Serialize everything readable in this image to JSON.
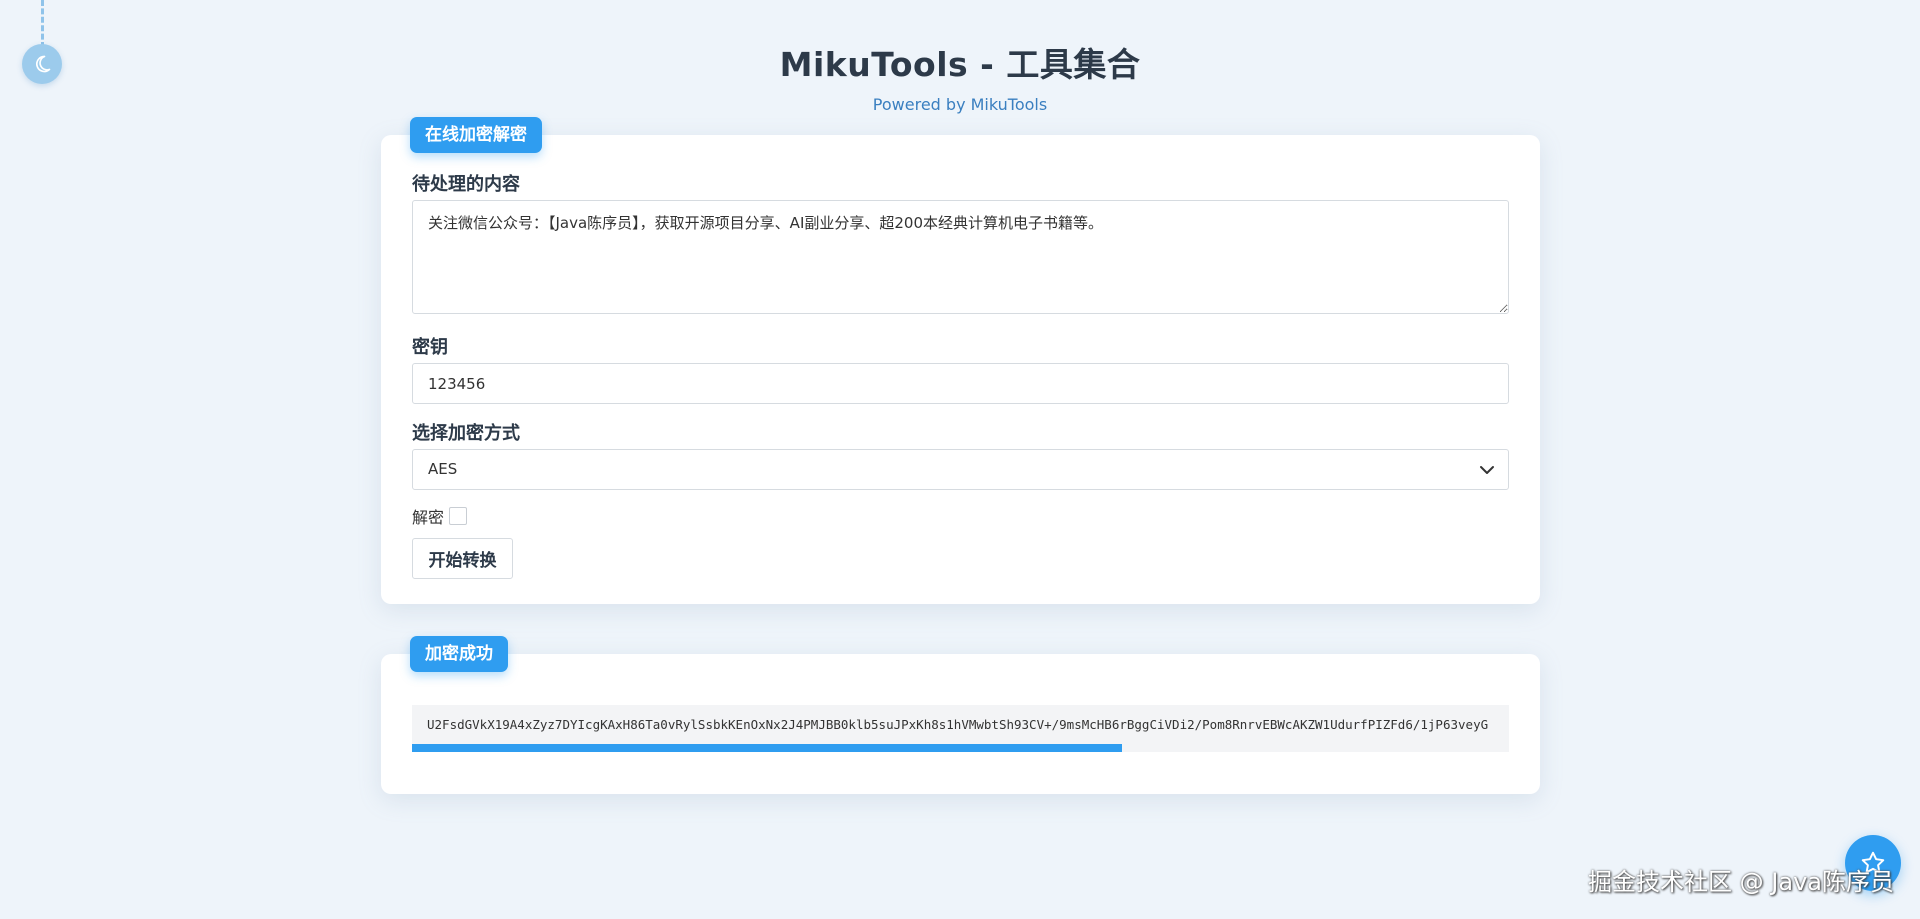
{
  "header": {
    "title": "MikuTools - 工具集合",
    "subtitle": "Powered by MikuTools"
  },
  "form_card": {
    "tag": "在线加密解密",
    "content_label": "待处理的内容",
    "content_value": "关注微信公众号：【Java陈序员】，获取开源项目分享、AI副业分享、超200本经典计算机电子书籍等。",
    "key_label": "密钥",
    "key_value": "123456",
    "method_label": "选择加密方式",
    "method_value": "AES",
    "decrypt_label": "解密",
    "decrypt_checked": false,
    "submit_label": "开始转换"
  },
  "result_card": {
    "tag": "加密成功",
    "output": "U2FsdGVkX19A4xZyz7DYIcgKAxH86Ta0vRylSsbkKEnOxNx2J4PMJBB0klb5suJPxKh8s1hVMwbtSh93CV+/9msMcHB6rBggCiVDi2/Pom8RnrvEBWcAKZW1UdurfPIZFd6/1jP63veyG",
    "progress_fraction": 0.647
  },
  "watermark": "掘金技术社区 @ Java陈序员",
  "colors": {
    "accent": "#2f9df0",
    "background": "#eef4fa"
  },
  "icons": {
    "theme_toggle": "moon-icon",
    "fab": "star-icon",
    "select": "chevron-down-icon"
  }
}
